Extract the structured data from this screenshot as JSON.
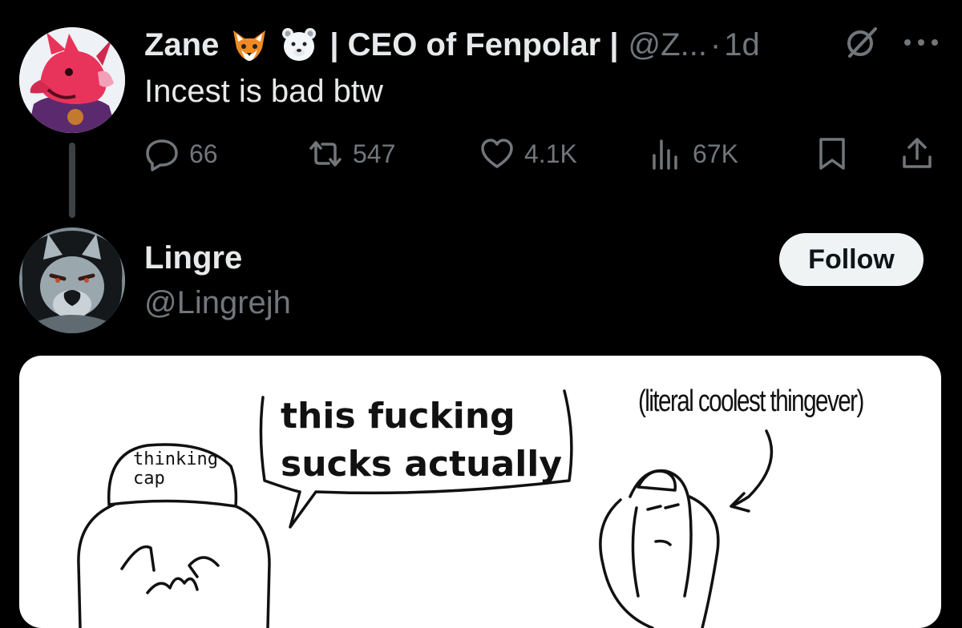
{
  "colors": {
    "background": "#000000",
    "primary_text": "#e7e9ea",
    "secondary_text": "#71767b",
    "follow_button_bg": "#eff3f4"
  },
  "tweet1": {
    "display_name": "Zane",
    "emojis": [
      "fox-emoji",
      "polar-bear-emoji"
    ],
    "title": "| CEO of Fenpolar |",
    "handle": "@Z...",
    "separator": "·",
    "time": "1d",
    "text": "Incest is bad btw",
    "actions": {
      "replies": "66",
      "retweets": "547",
      "likes": "4.1K",
      "views": "67K"
    }
  },
  "tweet2": {
    "display_name": "Lingre",
    "handle": "@Lingrejh",
    "follow_label": "Follow",
    "media": {
      "speech_line_1": "this fucking",
      "speech_line_2": "sucks actually",
      "caption": "(literal coolest thingever)",
      "cap_line_1": "thinking",
      "cap_line_2": "cap"
    }
  }
}
